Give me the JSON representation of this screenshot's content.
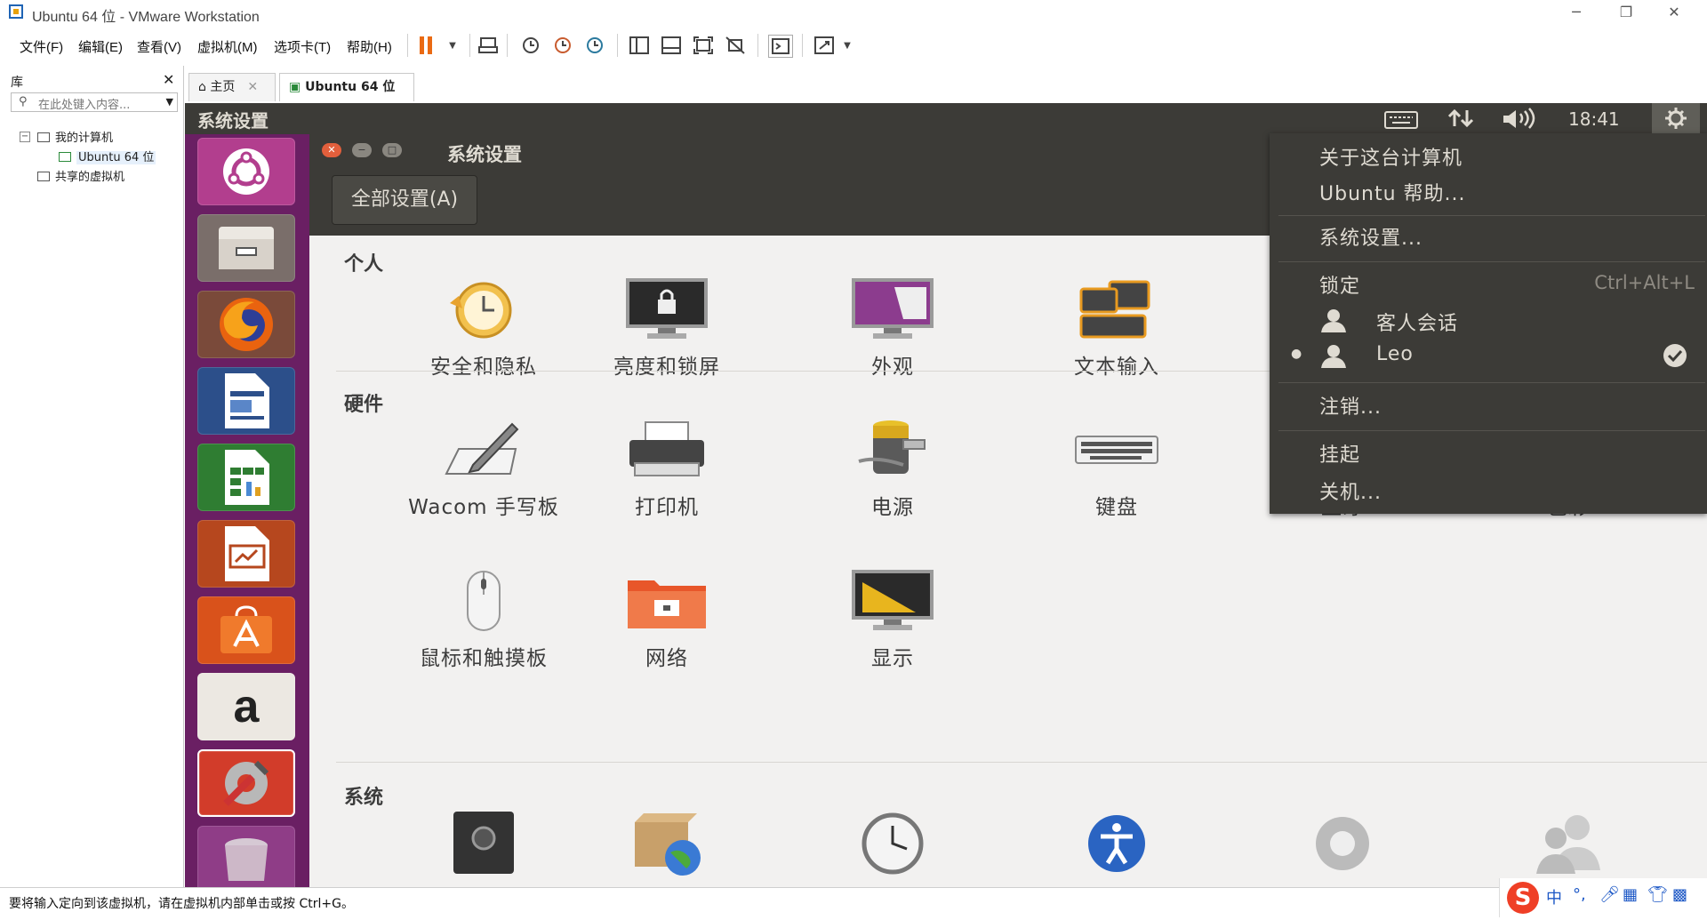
{
  "window": {
    "title": "Ubuntu 64 位 - VMware Workstation",
    "minimize": "─",
    "restore": "❐",
    "close": "✕"
  },
  "menubar": {
    "menus": [
      "文件(F)",
      "编辑(E)",
      "查看(V)",
      "虚拟机(M)",
      "选项卡(T)",
      "帮助(H)"
    ]
  },
  "library": {
    "heading": "库",
    "close": "✕",
    "search_placeholder": "在此处键入内容...",
    "tree": {
      "my_computer": "我的计算机",
      "vm": "Ubuntu 64 位",
      "shared": "共享的虚拟机"
    }
  },
  "tabs": [
    {
      "label": "主页",
      "active": false
    },
    {
      "label": "Ubuntu 64 位",
      "active": true
    }
  ],
  "ubuntu_panel": {
    "title": "系统设置",
    "clock": "18:41"
  },
  "settings": {
    "window_title": "系统设置",
    "all_settings_button": "全部设置(A)",
    "sections": {
      "personal": "个人",
      "hardware": "硬件",
      "system": "系统"
    },
    "personal_items": [
      "安全和隐私",
      "亮度和锁屏",
      "外观",
      "文本输入"
    ],
    "hardware_items": [
      "Wacom 手写板",
      "打印机",
      "电源",
      "键盘",
      "蓝牙",
      "色彩",
      "鼠标和触摸板",
      "网络",
      "显示"
    ]
  },
  "system_menu": {
    "about": "关于这台计算机",
    "help": "Ubuntu 帮助...",
    "system_settings": "系统设置...",
    "lock": "锁定",
    "lock_shortcut": "Ctrl+Alt+L",
    "guest_session": "客人会话",
    "user": "Leo",
    "logout": "注销...",
    "suspend": "挂起",
    "shutdown": "关机..."
  },
  "status_bar": {
    "message": "要将输入定向到该虚拟机，请在虚拟机内部单击或按 Ctrl+G。"
  },
  "ime": {
    "logo": "S",
    "mode": "中"
  }
}
